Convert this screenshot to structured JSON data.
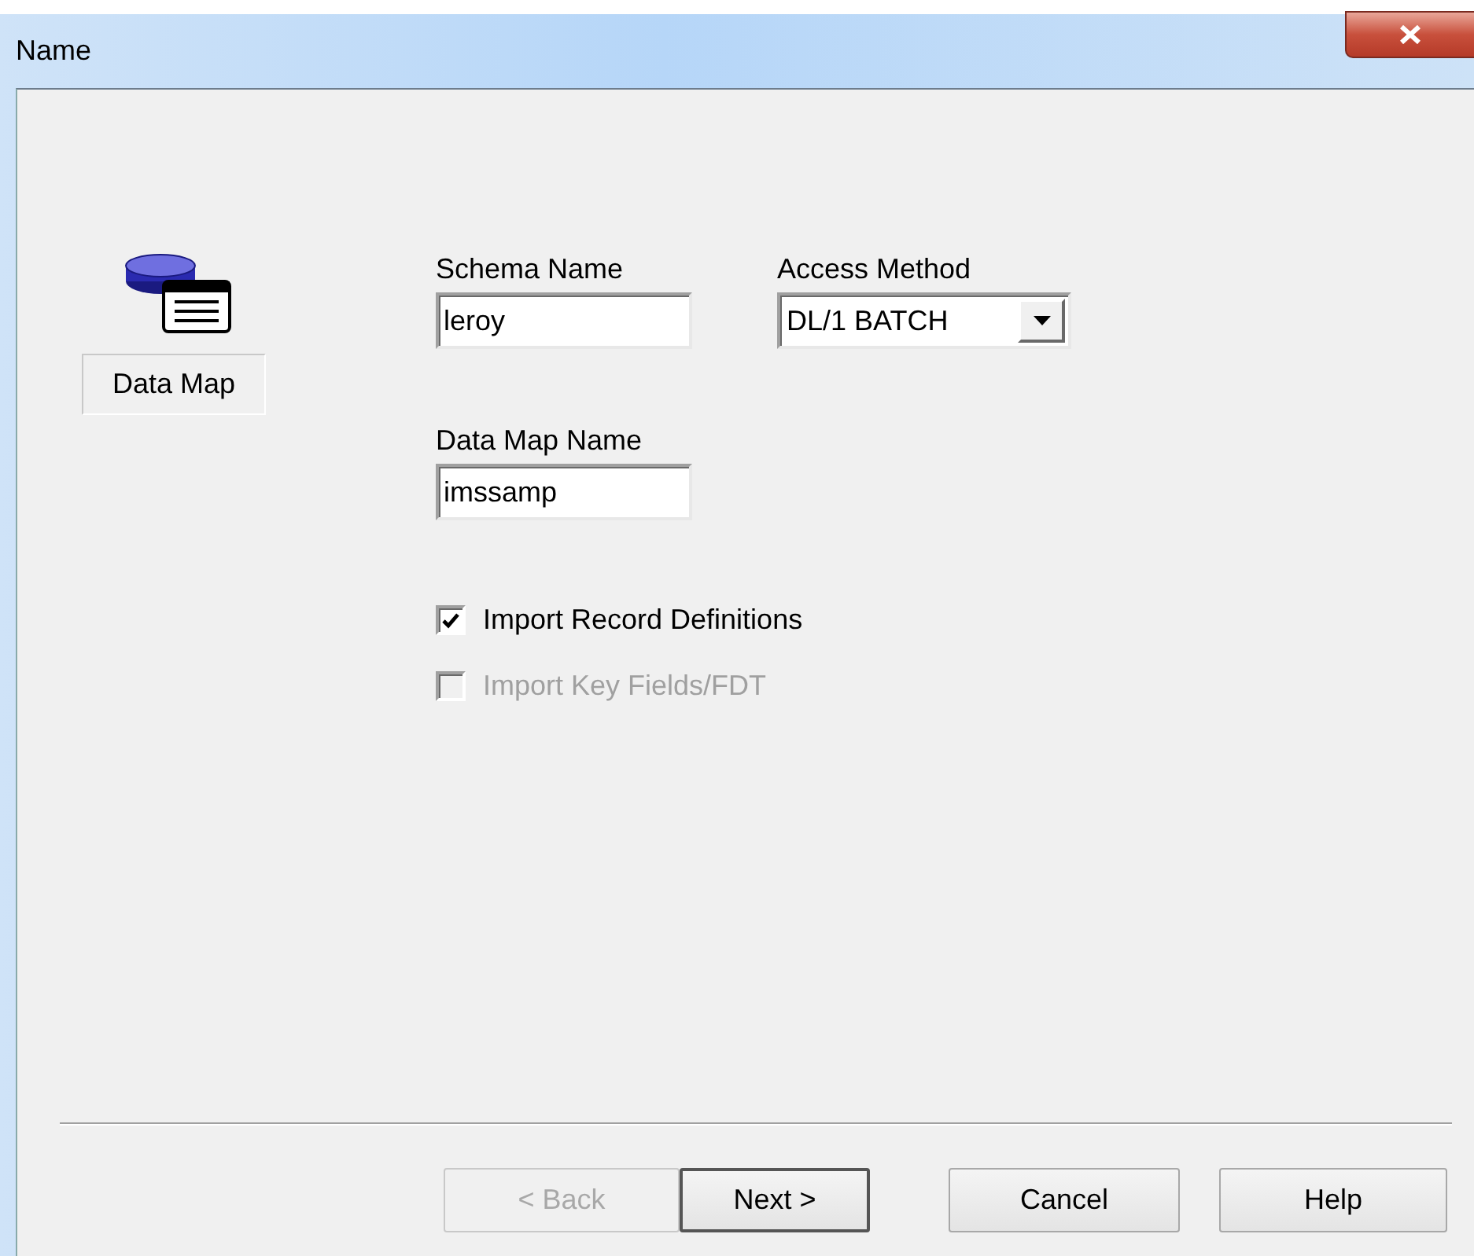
{
  "window": {
    "title": "Name"
  },
  "object_type": {
    "label": "Data Map"
  },
  "fields": [
    {
      "kind": "text",
      "label": "Schema Name",
      "value": "leroy"
    },
    {
      "kind": "combo",
      "label": "Access Method",
      "value": "DL/1 BATCH"
    },
    {
      "kind": "text",
      "label": "Data Map Name",
      "value": "imssamp"
    }
  ],
  "options": [
    {
      "label": "Import Record Definitions",
      "checked": true,
      "disabled": false
    },
    {
      "label": "Import Key Fields/FDT",
      "checked": false,
      "disabled": true
    }
  ],
  "buttons": [
    {
      "label": "< Back",
      "disabled": true,
      "default": false
    },
    {
      "label": "Next >",
      "disabled": false,
      "default": true
    },
    {
      "label": "Cancel",
      "disabled": false,
      "default": false
    },
    {
      "label": "Help",
      "disabled": false,
      "default": false
    }
  ]
}
